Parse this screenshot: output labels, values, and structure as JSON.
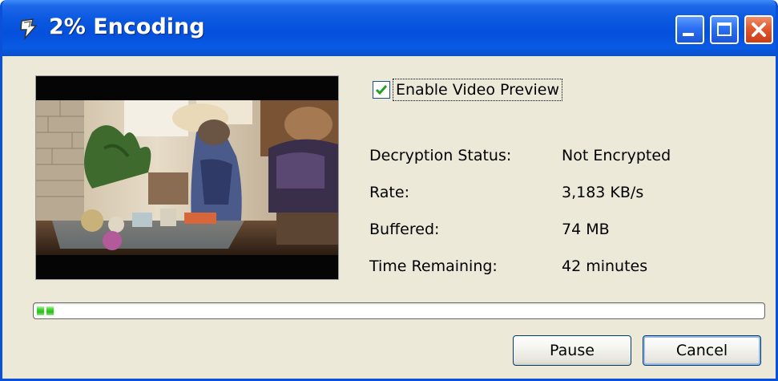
{
  "window": {
    "title": "2% Encoding",
    "app_icon": "encoder-icon",
    "controls": [
      "minimize-icon",
      "maximize-icon",
      "close-icon"
    ],
    "accent_color": "#0a58e0",
    "close_color": "#e2582f"
  },
  "preview": {
    "enable_label": "Enable Video Preview",
    "enabled": true
  },
  "info": {
    "rows": [
      {
        "label": "Decryption Status:",
        "value": "Not Encrypted"
      },
      {
        "label": "Rate:",
        "value": "3,183 KB/s"
      },
      {
        "label": "Buffered:",
        "value": "74 MB"
      },
      {
        "label": "Time Remaining:",
        "value": "42 minutes"
      }
    ]
  },
  "progress": {
    "percent": 2,
    "color": "#3cd52a"
  },
  "buttons": {
    "pause_label": "Pause",
    "cancel_label": "Cancel"
  }
}
